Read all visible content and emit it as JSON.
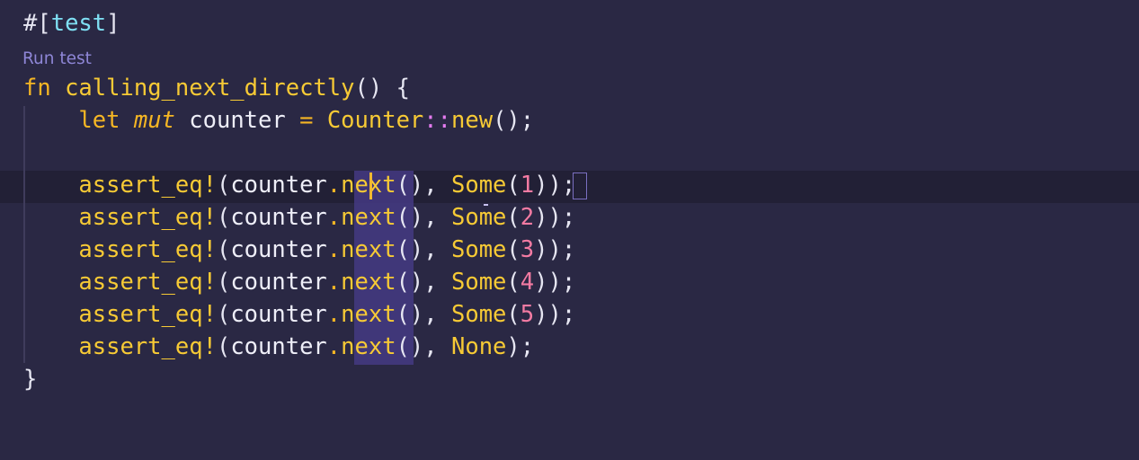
{
  "code": {
    "attr": {
      "hash": "#[",
      "name": "test",
      "close": "]"
    },
    "code_lens": "Run test",
    "fn_line": {
      "keyword": "fn",
      "name": "calling_next_directly",
      "parens": "()",
      "brace": "{"
    },
    "let_line": {
      "keyword": "let",
      "mut": "mut",
      "var": "counter",
      "eq": "=",
      "type": "Counter",
      "path_sep": "::",
      "ctor": "new",
      "tail": "();"
    },
    "asserts": [
      {
        "macro": "assert_eq!",
        "open": "(",
        "recv": "counter",
        "dot": ".",
        "method": "next",
        "call": "()",
        "comma": ",",
        "variant": "Some",
        "arg_open": "(",
        "arg": "1",
        "arg_close": ")",
        "tail": ");"
      },
      {
        "macro": "assert_eq!",
        "open": "(",
        "recv": "counter",
        "dot": ".",
        "method": "next",
        "call": "()",
        "comma": ",",
        "variant": "Some",
        "arg_open": "(",
        "arg": "2",
        "arg_close": ")",
        "tail": ");"
      },
      {
        "macro": "assert_eq!",
        "open": "(",
        "recv": "counter",
        "dot": ".",
        "method": "next",
        "call": "()",
        "comma": ",",
        "variant": "Some",
        "arg_open": "(",
        "arg": "3",
        "arg_close": ")",
        "tail": ");"
      },
      {
        "macro": "assert_eq!",
        "open": "(",
        "recv": "counter",
        "dot": ".",
        "method": "next",
        "call": "()",
        "comma": ",",
        "variant": "Some",
        "arg_open": "(",
        "arg": "4",
        "arg_close": ")",
        "tail": ");"
      },
      {
        "macro": "assert_eq!",
        "open": "(",
        "recv": "counter",
        "dot": ".",
        "method": "next",
        "call": "()",
        "comma": ",",
        "variant": "Some",
        "arg_open": "(",
        "arg": "5",
        "arg_close": ")",
        "tail": ");"
      },
      {
        "macro": "assert_eq!",
        "open": "(",
        "recv": "counter",
        "dot": ".",
        "method": "next",
        "call": "()",
        "comma": ",",
        "variant": "None",
        "tail": ");"
      }
    ],
    "closing_brace": "}"
  },
  "colors": {
    "background": "#2a2844",
    "current_line": "#222036",
    "selection": "#443a82",
    "keyword": "#f5b624",
    "function": "#f7ca35",
    "number": "#f47ba3",
    "attribute": "#7fe0f4",
    "code_lens": "#8e86d6"
  }
}
